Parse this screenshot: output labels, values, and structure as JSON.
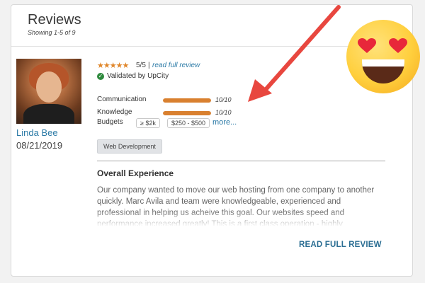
{
  "header": {
    "title": "Reviews",
    "subtitle": "Showing 1-5 of 9"
  },
  "reviewer": {
    "name": "Linda Bee",
    "date": "08/21/2019"
  },
  "rating": {
    "stars": "★★★★★",
    "value": "5/5",
    "separator": "|",
    "read_full_link": "read full review"
  },
  "validation": {
    "icon": "check-circle-icon",
    "text": "Validated by UpCity"
  },
  "metrics": [
    {
      "label": "Communication",
      "value": "10/10",
      "fraction": 1.0
    },
    {
      "label": "Knowledge",
      "value": "10/10",
      "fraction": 1.0
    }
  ],
  "budget": {
    "label": "Budgets",
    "options": [
      "≥ $2k",
      "$250 - $500"
    ],
    "more_link": "more..."
  },
  "tags": [
    "Web Development"
  ],
  "experience": {
    "heading": "Overall Experience",
    "body": "Our company wanted to move our web hosting from one company to another quickly. Marc Avila and team were knowledgeable, experienced and professional in helping us acheive this goal. Our websites speed and performance increased greatly! This is a first class operation - highly recommended for business class"
  },
  "actions": {
    "read_full_review": "READ FULL REVIEW"
  },
  "overlays": {
    "arrow": "red-arrow-icon",
    "emoji": "heart-eyes-emoji-icon"
  },
  "colors": {
    "accent_orange": "#d9802f",
    "link_blue": "#2b7aa6",
    "validated_green": "#2e8a3d",
    "arrow_red": "#e8473f"
  }
}
